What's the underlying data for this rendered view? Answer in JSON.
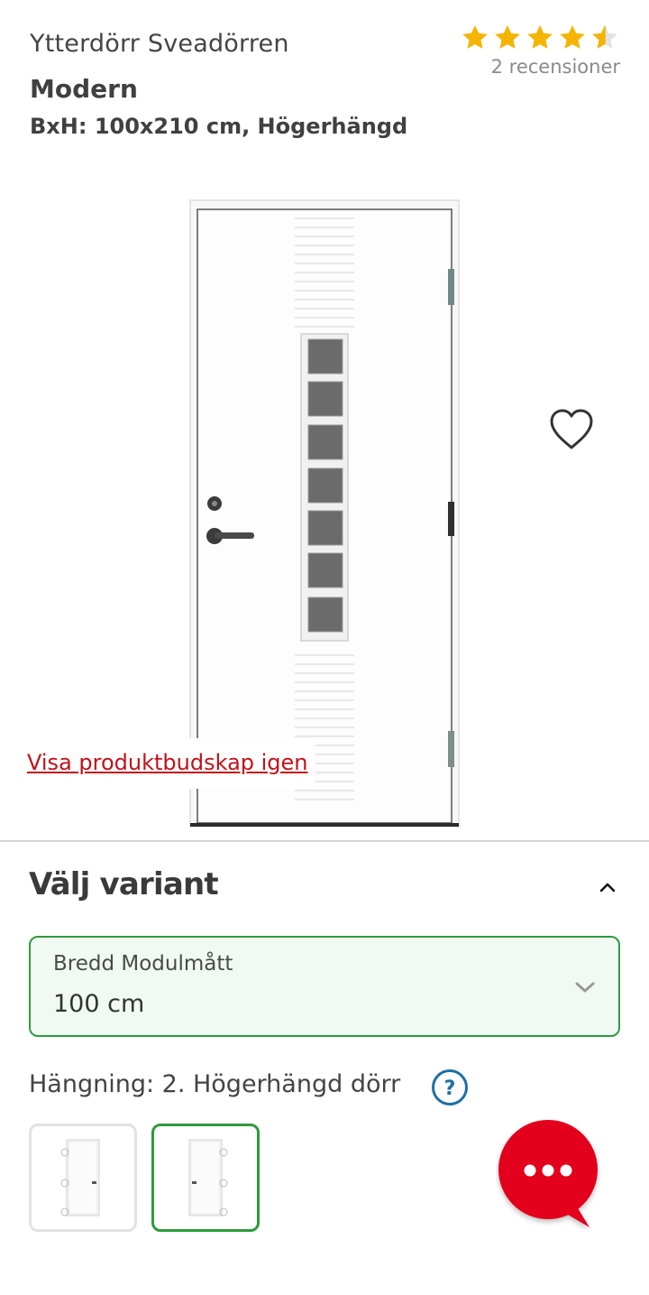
{
  "product": {
    "brand_line": "Ytterdörr Sveadörren",
    "model": "Modern",
    "dimensions": "BxH: 100x210 cm, Högerhängd"
  },
  "rating": {
    "score": 4.5,
    "max": 5,
    "reviews_label": "2 recensioner",
    "star_color": "#f5b400"
  },
  "image": {
    "show_message_link": "Visa produktbudskap igen",
    "favorite_icon": "heart-outline-icon"
  },
  "variant": {
    "section_title": "Välj variant",
    "width_select": {
      "label": "Bredd Modulmått",
      "value": "100 cm"
    },
    "hanging": {
      "label": "Hängning: 2. Högerhängd dörr",
      "help_icon": "question-circle-icon",
      "selected_index": 1
    }
  },
  "colors": {
    "accent_green": "#2e9b3e",
    "brand_red": "#e2001a",
    "link_red": "#c1121a",
    "help_blue": "#1d6fa5"
  }
}
